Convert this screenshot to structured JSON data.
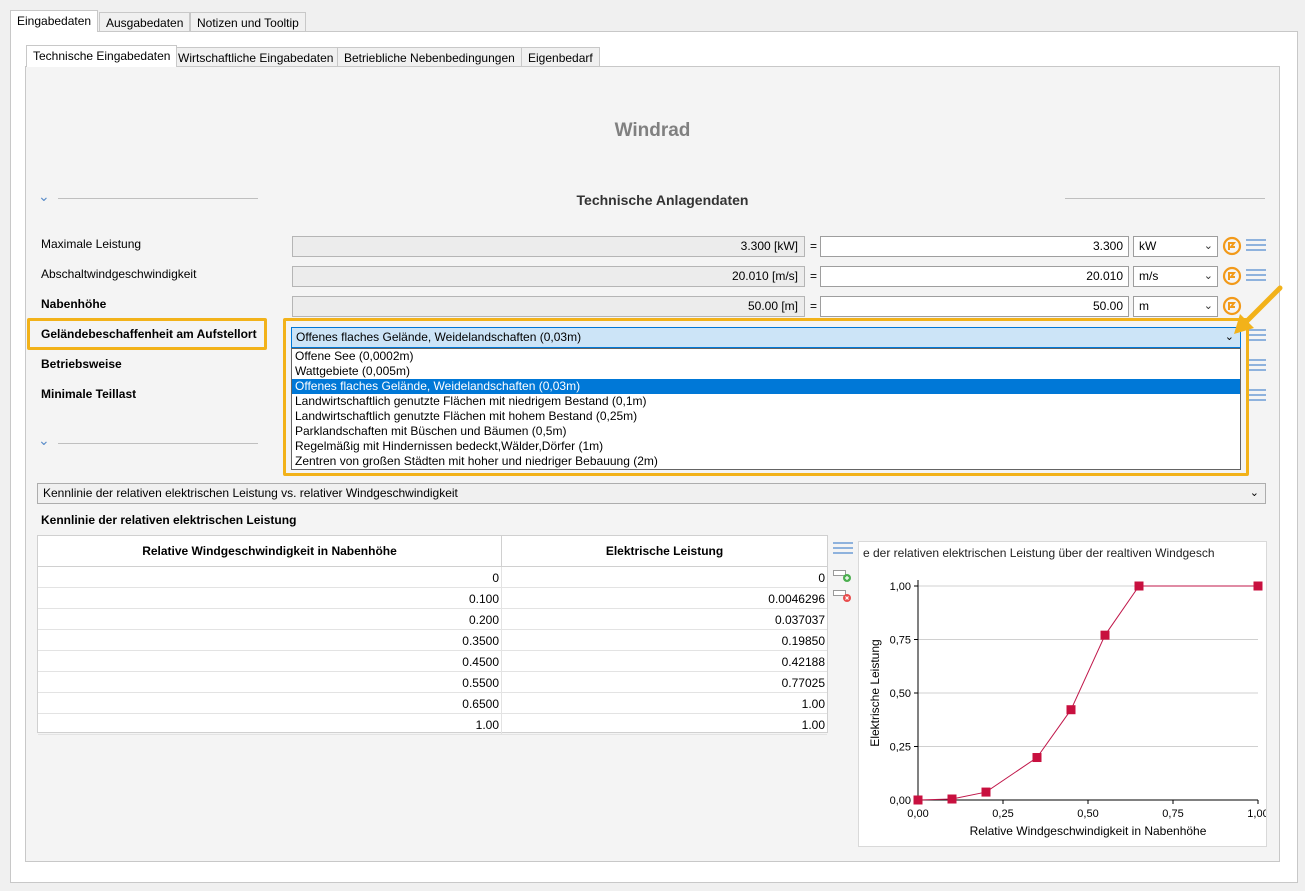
{
  "top_tabs": [
    "Eingabedaten",
    "Ausgabedaten",
    "Notizen und Tooltip"
  ],
  "sub_tabs": [
    "Technische Eingabedaten",
    "Wirtschaftliche Eingabedaten",
    "Betriebliche Nebenbedingungen",
    "Eigenbedarf"
  ],
  "page_title": "Windrad",
  "section_title": "Technische Anlagendaten",
  "fields": [
    {
      "label": "Maximale Leistung",
      "computed": "3.300 [kW]",
      "eq": "=",
      "value": "3.300",
      "unit": "kW"
    },
    {
      "label": "Abschaltwindgeschwindigkeit",
      "computed": "20.010 [m/s]",
      "eq": "=",
      "value": "20.010",
      "unit": "m/s"
    },
    {
      "label": "Nabenhöhe",
      "computed": "50.00 [m]",
      "eq": "=",
      "value": "50.00",
      "unit": "m"
    }
  ],
  "labels_more": [
    "Geländebeschaffenheit am Aufstellort",
    "Betriebsweise",
    "Minimale Teillast"
  ],
  "terrain_dropdown": {
    "selected": "Offenes flaches Gelände, Weidelandschaften (0,03m)",
    "options": [
      "Offene See (0,0002m)",
      "Wattgebiete (0,005m)",
      "Offenes flaches Gelände, Weidelandschaften (0,03m)",
      "Landwirtschaftlich genutzte Flächen mit niedrigem Bestand (0,1m)",
      "Landwirtschaftlich genutzte Flächen mit hohem Bestand (0,25m)",
      "Parklandschaften mit Büschen und Bäumen (0,5m)",
      "Regelmäßig mit Hindernissen bedeckt,Wälder,Dörfer (1m)",
      "Zentren von großen Städten mit hoher und niedriger Bebauung (2m)"
    ],
    "selected_index": 2
  },
  "curve_combo": "Kennlinie der relativen elektrischen Leistung vs. relativer Windgeschwindigkeit",
  "table_title": "Kennlinie der relativen elektrischen Leistung",
  "table": {
    "headers": [
      "Relative Windgeschwindigkeit in Nabenhöhe",
      "Elektrische Leistung"
    ],
    "rows": [
      [
        "0",
        "0"
      ],
      [
        "0.100",
        "0.0046296"
      ],
      [
        "0.200",
        "0.037037"
      ],
      [
        "0.3500",
        "0.19850"
      ],
      [
        "0.4500",
        "0.42188"
      ],
      [
        "0.5500",
        "0.77025"
      ],
      [
        "0.6500",
        "1.00"
      ],
      [
        "1.00",
        "1.00"
      ]
    ]
  },
  "chart_data": {
    "type": "line",
    "title": "e der relativen elektrischen Leistung über der realtiven Windgesch",
    "xlabel": "Relative Windgeschwindigkeit in Nabenhöhe",
    "ylabel": "Elektrische Leistung",
    "xlim": [
      0,
      1
    ],
    "ylim": [
      0,
      1
    ],
    "x_ticks": [
      "0,00",
      "0,25",
      "0,50",
      "0,75",
      "1,00"
    ],
    "y_ticks": [
      "0,00",
      "0,25",
      "0,50",
      "0,75",
      "1,00"
    ],
    "grid": true,
    "series": [
      {
        "x": [
          0,
          0.1,
          0.2,
          0.35,
          0.45,
          0.55,
          0.65,
          1.0
        ],
        "values": [
          0,
          0.0046296,
          0.037037,
          0.1985,
          0.42188,
          0.77025,
          1.0,
          1.0
        ]
      }
    ],
    "line_color": "#c0174a",
    "marker_color": "#c8103f"
  },
  "colors": {
    "highlight": "#f2b21a",
    "selection": "#0078d7",
    "accent_orange": "#f29a1a"
  }
}
